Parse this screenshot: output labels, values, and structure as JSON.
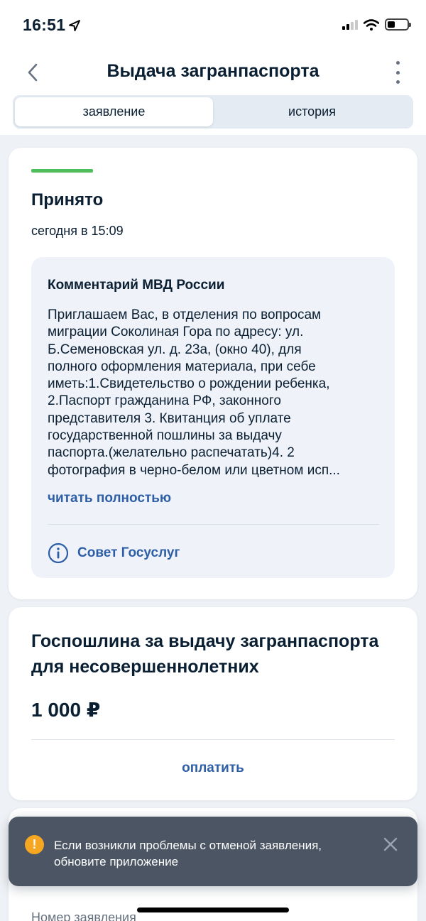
{
  "status_bar": {
    "time": "16:51"
  },
  "header": {
    "title": "Выдача загранпаспорта"
  },
  "tabs": [
    {
      "label": "заявление",
      "active": true
    },
    {
      "label": "история",
      "active": false
    }
  ],
  "status_card": {
    "status": "Принято",
    "status_color": "#4dbe5b",
    "date": "сегодня в 15:09",
    "comment": {
      "title": "Комментарий МВД России",
      "lines": [
        "Приглашаем Вас, в отделения по вопросам",
        "миграции Соколиная Гора по адресу: ул.",
        "Б.Семеновская ул. д. 23а, (окно 40), для",
        "полного оформления материала, при себе",
        "иметь:1.Свидетельство о рождении ребенка,",
        "2.Паспорт гражданина РФ, законного",
        "представителя 3. Квитанция об уплате",
        "государственной пошлины за выдачу",
        "паспорта.(желательно распечатать)4. 2",
        "фотография в черно-белом или цветном исп..."
      ],
      "read_more": "читать полностью",
      "advice": "Совет Госуслуг"
    }
  },
  "fee_card": {
    "title_lines": [
      "Госпошлина за выдачу загранпаспорта",
      "для несовершеннолетних"
    ],
    "amount": "1 000 ₽",
    "pay_label": "оплатить"
  },
  "app_card": {
    "number_label": "Номер заявления"
  },
  "toast": {
    "icon": "!",
    "lines": [
      "Если возникли проблемы с отменой заявления,",
      "обновите приложение"
    ]
  },
  "colors": {
    "accent_link": "#2d5ea6",
    "warning": "#f5a623",
    "toast_bg": "#4b5564"
  }
}
